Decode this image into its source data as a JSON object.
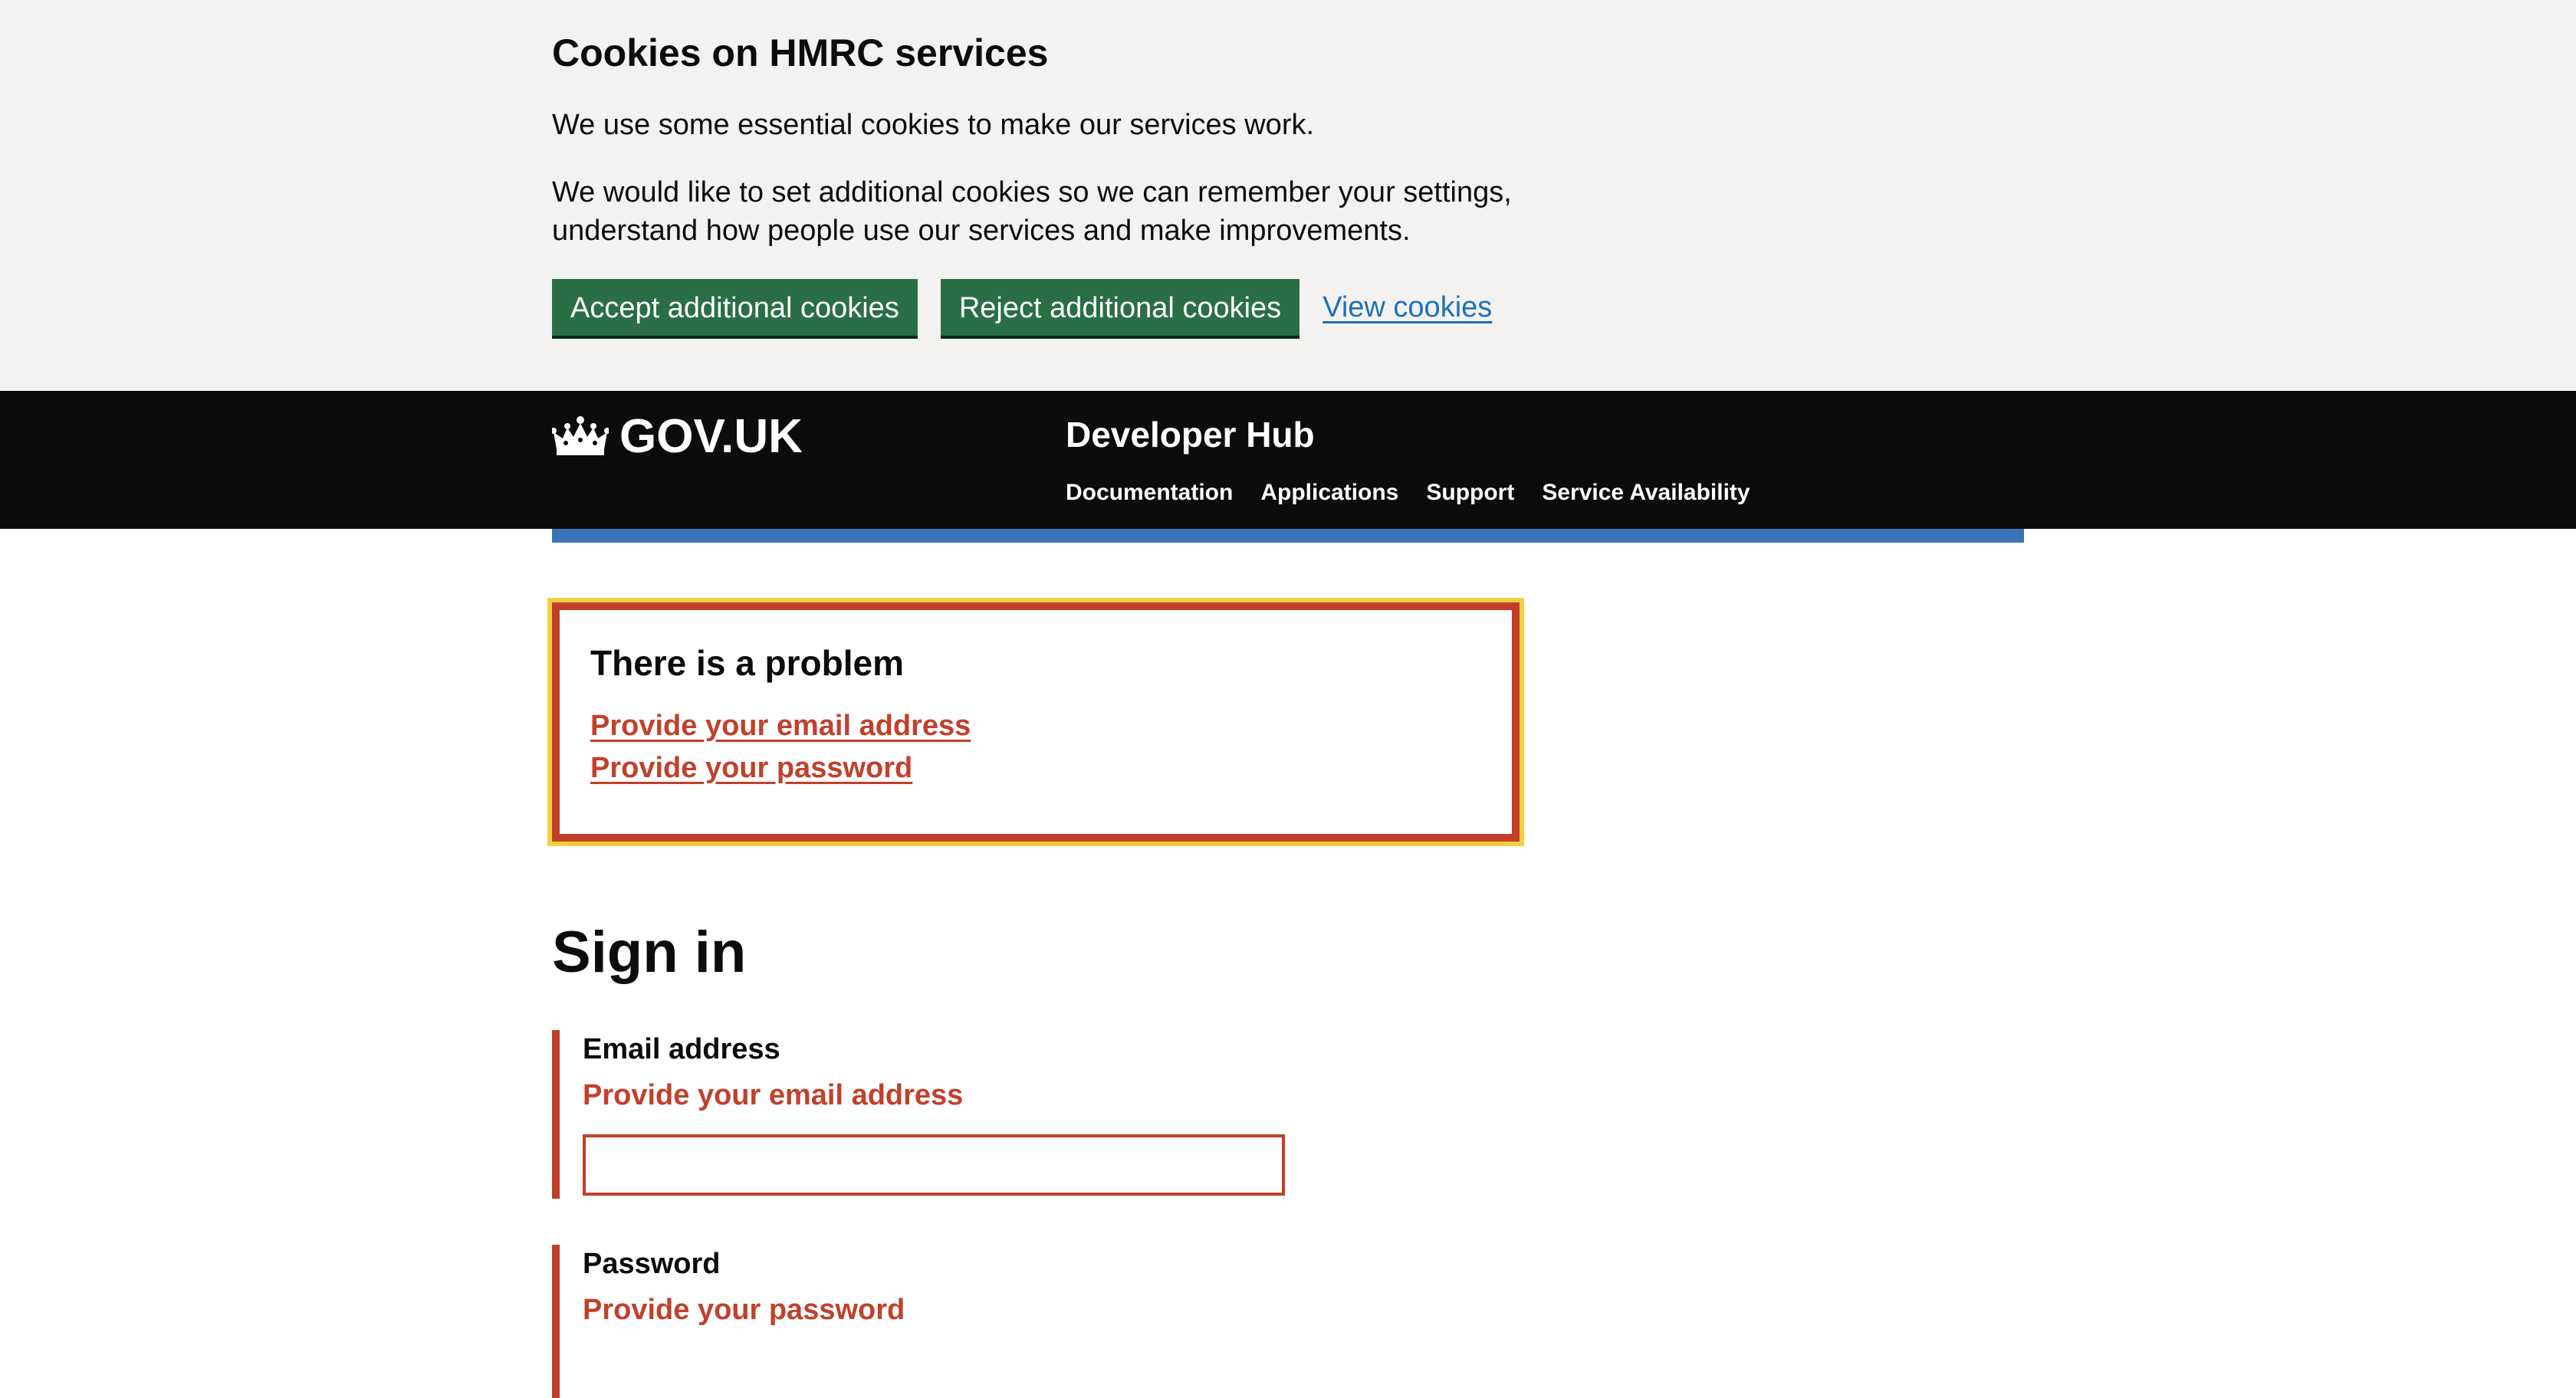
{
  "cookie_banner": {
    "title": "Cookies on HMRC services",
    "paragraph_1": "We use some essential cookies to make our services work.",
    "paragraph_2": "We would like to set additional cookies so we can remember your settings, understand how people use our services and make improvements.",
    "accept_label": "Accept additional cookies",
    "reject_label": "Reject additional cookies",
    "view_label": "View cookies"
  },
  "header": {
    "logo_text": "GOV.UK",
    "service_name": "Developer Hub",
    "nav": [
      "Documentation",
      "Applications",
      "Support",
      "Service Availability"
    ]
  },
  "error_summary": {
    "title": "There is a problem",
    "errors": [
      "Provide your email address",
      "Provide your password"
    ]
  },
  "main": {
    "title": "Sign in",
    "email": {
      "label": "Email address",
      "error": "Provide your email address",
      "value": ""
    },
    "password": {
      "label": "Password",
      "error": "Provide your password"
    }
  },
  "colors": {
    "green_button": "#2a6e45",
    "error_red": "#c2402a",
    "focus_yellow": "#f2cf3c",
    "link_blue": "#1d70b8",
    "header_black": "#0b0c0c",
    "banner_grey": "#f3f2f1"
  }
}
